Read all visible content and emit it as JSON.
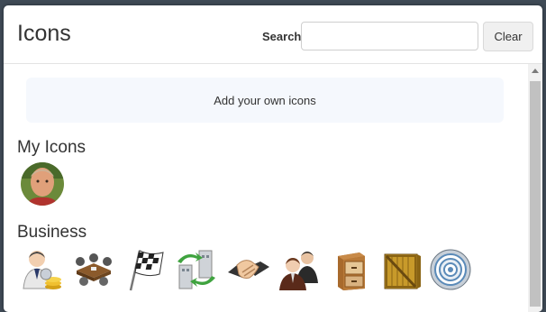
{
  "header": {
    "title": "Icons",
    "search_label": "Search",
    "search_value": "",
    "clear_label": "Clear"
  },
  "add_panel": {
    "label": "Add your own icons"
  },
  "sections": [
    {
      "title": "My Icons",
      "icons": [
        "user-photo-avatar"
      ]
    },
    {
      "title": "Business",
      "icons": [
        "businessman-coins-icon",
        "meeting-table-icon",
        "checkered-flag-icon",
        "transfer-buildings-icon",
        "handshake-icon",
        "business-people-icon",
        "file-cabinet-icon",
        "wooden-crate-icon",
        "target-icon"
      ]
    }
  ]
}
